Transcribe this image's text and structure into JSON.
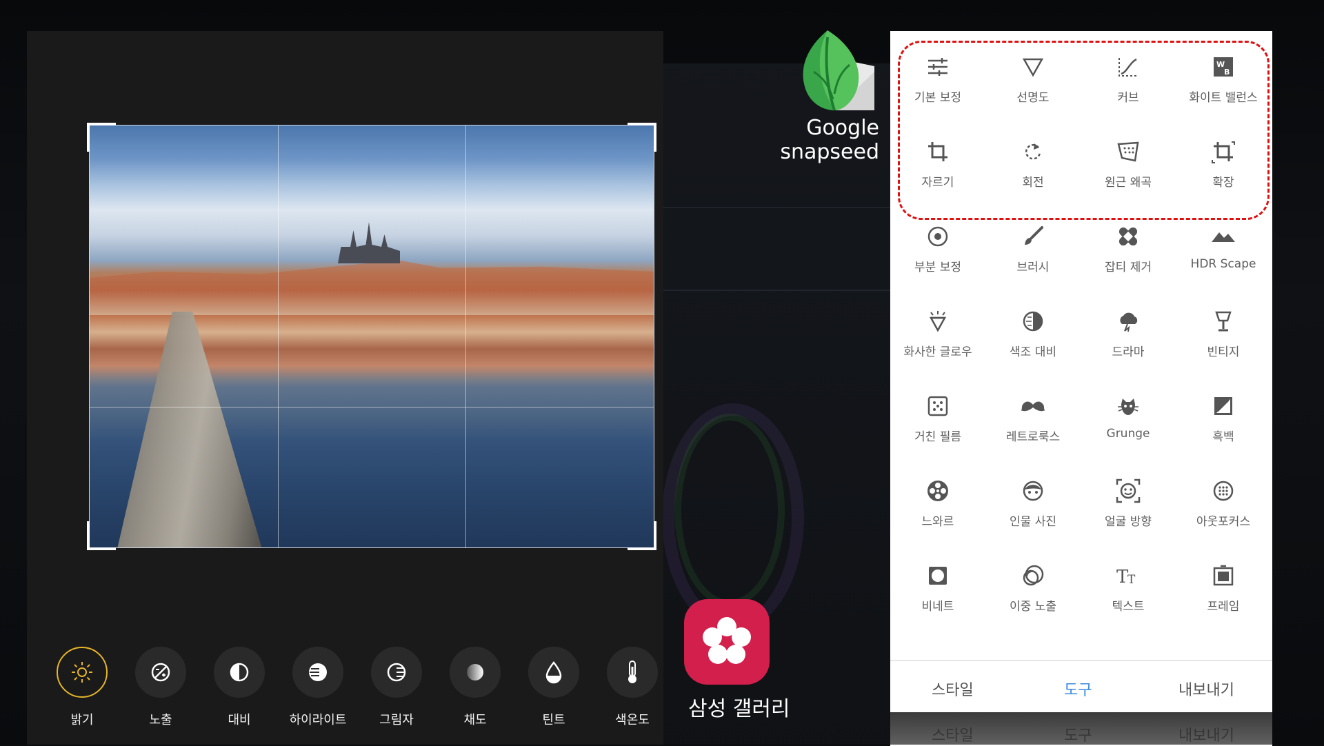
{
  "samsung_gallery": {
    "adjustments": [
      {
        "label": "밝기",
        "icon": "brightness-icon",
        "active": true
      },
      {
        "label": "노출",
        "icon": "exposure-icon",
        "active": false
      },
      {
        "label": "대비",
        "icon": "contrast-icon",
        "active": false
      },
      {
        "label": "하이라이트",
        "icon": "highlights-icon",
        "active": false
      },
      {
        "label": "그림자",
        "icon": "shadows-icon",
        "active": false
      },
      {
        "label": "채도",
        "icon": "saturation-icon",
        "active": false
      },
      {
        "label": "틴트",
        "icon": "tint-icon",
        "active": false
      },
      {
        "label": "색온도",
        "icon": "temperature-icon",
        "active": false
      }
    ],
    "app_label": "삼성 갤러리",
    "accent_color": "#e7b52a",
    "logo_color": "#d31f4c"
  },
  "snapseed": {
    "brand_line1": "Google",
    "brand_line2": "snapseed",
    "tools": [
      {
        "label": "기본 보정",
        "icon": "tune-image-icon"
      },
      {
        "label": "선명도",
        "icon": "details-icon"
      },
      {
        "label": "커브",
        "icon": "curves-icon"
      },
      {
        "label": "화이트 밸런스",
        "icon": "white-balance-icon"
      },
      {
        "label": "자르기",
        "icon": "crop-icon"
      },
      {
        "label": "회전",
        "icon": "rotate-icon"
      },
      {
        "label": "원근 왜곡",
        "icon": "perspective-icon"
      },
      {
        "label": "확장",
        "icon": "expand-icon"
      },
      {
        "label": "부분 보정",
        "icon": "selective-icon"
      },
      {
        "label": "브러시",
        "icon": "brush-icon"
      },
      {
        "label": "잡티 제거",
        "icon": "healing-icon"
      },
      {
        "label": "HDR Scape",
        "icon": "hdr-icon"
      },
      {
        "label": "화사한 글로우",
        "icon": "glamour-glow-icon"
      },
      {
        "label": "색조 대비",
        "icon": "tonal-contrast-icon"
      },
      {
        "label": "드라마",
        "icon": "drama-icon"
      },
      {
        "label": "빈티지",
        "icon": "vintage-icon"
      },
      {
        "label": "거친 필름",
        "icon": "grainy-film-icon"
      },
      {
        "label": "레트로룩스",
        "icon": "retrolux-icon"
      },
      {
        "label": "Grunge",
        "icon": "grunge-icon"
      },
      {
        "label": "흑백",
        "icon": "black-white-icon"
      },
      {
        "label": "느와르",
        "icon": "noir-icon"
      },
      {
        "label": "인물 사진",
        "icon": "portrait-icon"
      },
      {
        "label": "얼굴 방향",
        "icon": "head-pose-icon"
      },
      {
        "label": "아웃포커스",
        "icon": "lens-blur-icon"
      },
      {
        "label": "비네트",
        "icon": "vignette-icon"
      },
      {
        "label": "이중 노출",
        "icon": "double-exposure-icon"
      },
      {
        "label": "텍스트",
        "icon": "text-icon"
      },
      {
        "label": "프레임",
        "icon": "frames-icon"
      }
    ],
    "bottom_tabs": [
      {
        "label": "스타일",
        "active": false
      },
      {
        "label": "도구",
        "active": true
      },
      {
        "label": "내보내기",
        "active": false
      }
    ],
    "below_tabs": [
      "스타일",
      "도구",
      "내보내기"
    ],
    "active_tab_color": "#3d8be0",
    "highlight_color": "#e01010"
  }
}
